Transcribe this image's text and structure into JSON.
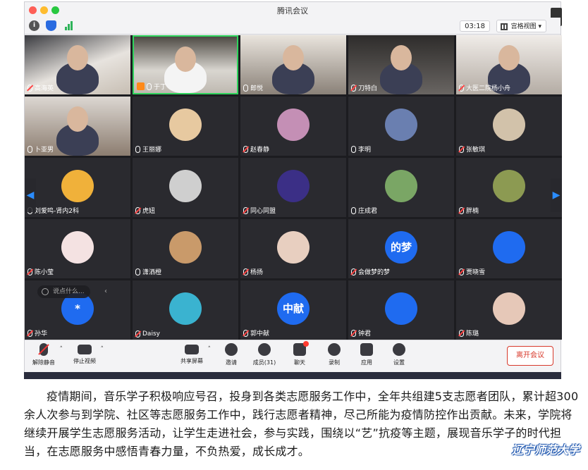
{
  "window": {
    "title": "腾讯会议",
    "timer": "03:18",
    "view_label": "宫格视图"
  },
  "participants": [
    {
      "name": "高海英",
      "type": "video",
      "muted": true
    },
    {
      "name": "于丁",
      "type": "video",
      "muted": false,
      "active": true
    },
    {
      "name": "郎悦",
      "type": "video",
      "muted": false
    },
    {
      "name": "刀特白",
      "type": "video",
      "muted": true
    },
    {
      "name": "大医二院杨小舟",
      "type": "video",
      "muted": true
    },
    {
      "name": "卜亚男",
      "type": "video",
      "muted": false
    },
    {
      "name": "王丽娜",
      "type": "avatar",
      "muted": false
    },
    {
      "name": "赵春静",
      "type": "avatar",
      "muted": true
    },
    {
      "name": "李明",
      "type": "avatar",
      "muted": false
    },
    {
      "name": "张敏琪",
      "type": "avatar",
      "muted": true
    },
    {
      "name": "刘爱鸣-肾内2科",
      "type": "avatar",
      "muted": false
    },
    {
      "name": "虎妞",
      "type": "avatar",
      "muted": true
    },
    {
      "name": "同心同盟",
      "type": "avatar",
      "muted": true
    },
    {
      "name": "庄成君",
      "type": "avatar",
      "muted": false
    },
    {
      "name": "胖楠",
      "type": "avatar",
      "muted": true
    },
    {
      "name": "陈小莹",
      "type": "avatar",
      "muted": true
    },
    {
      "name": "潇洒橙",
      "type": "avatar",
      "muted": false
    },
    {
      "name": "杨扬",
      "type": "avatar",
      "muted": true
    },
    {
      "name": "会做梦的梦",
      "type": "avatar",
      "muted": true,
      "avatar_text": "的梦"
    },
    {
      "name": "贾晓雪",
      "type": "avatar",
      "muted": true
    },
    {
      "name": "孙华",
      "type": "avatar",
      "muted": true,
      "avatar_text": "*"
    },
    {
      "name": "Daisy",
      "type": "avatar",
      "muted": true
    },
    {
      "name": "郭中献",
      "type": "avatar",
      "muted": true,
      "avatar_text": "中献"
    },
    {
      "name": "钟君",
      "type": "avatar",
      "muted": true
    },
    {
      "name": "陈璐",
      "type": "avatar",
      "muted": true
    }
  ],
  "chat": {
    "placeholder": "说点什么..."
  },
  "toolbar": {
    "unmute": "解除静音",
    "stop_video": "停止视频",
    "share_screen": "共享屏幕",
    "invite": "邀请",
    "members": "成员(31)",
    "chat": "聊天",
    "record": "录制",
    "apps": "应用",
    "settings": "设置",
    "leave": "离开会议"
  },
  "caption": "疫情期间，音乐学子积极响应号召，投身到各类志愿服务工作中，全年共组建5支志愿者团队，累计超300余人次参与到学院、社区等志愿服务工作中，践行志愿者精神，尽己所能为疫情防控作出贡献。未来，学院将继续开展学生志愿服务活动，让学生走进社会，参与实践，围绕以“艺”抗疫等主题，展现音乐学子的时代担当，在志愿服务中感悟青春力量，不负热爱，成长成才。",
  "watermark": "辽宁师范大学",
  "colors": {
    "accent_blue": "#1f6bf0",
    "leave_red": "#d8392b",
    "active_green": "#2fd35c"
  }
}
